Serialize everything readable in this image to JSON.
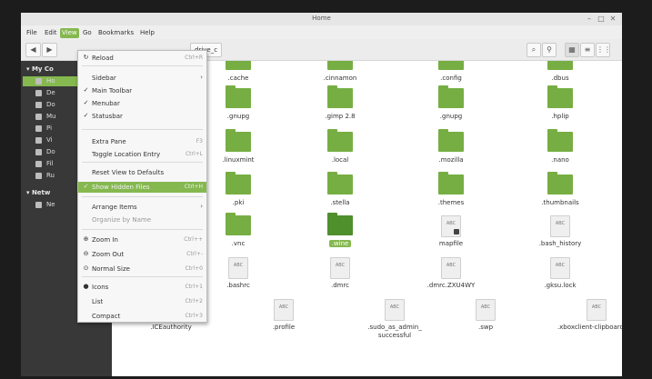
{
  "window": {
    "title": "Home"
  },
  "menubar": [
    "File",
    "Edit",
    "View",
    "Go",
    "Bookmarks",
    "Help"
  ],
  "toolbar": {
    "back_icon": "arrow-left-icon",
    "forward_icon": "arrow-right-icon",
    "path_crumb": "drive_c",
    "terminal_icon": "terminal-icon",
    "search_icon": "search-icon",
    "view_icons_icon": "grid-icon",
    "view_list_icon": "list-icon",
    "view_compact_icon": "compact-icon"
  },
  "sidebar": {
    "sections": [
      {
        "label": "My Co",
        "items": [
          "Ho",
          "De",
          "Do",
          "Mu",
          "Pi",
          "Vi",
          "Do",
          "Fil",
          "Ru"
        ]
      },
      {
        "label": "Netw",
        "items": [
          "Ne"
        ]
      }
    ]
  },
  "view_menu": {
    "items": [
      {
        "label": "Reload",
        "shortcut": "Ctrl+R",
        "mark": "↻"
      },
      {
        "label": "Sidebar",
        "shortcut": "",
        "mark": "",
        "submenu": true
      },
      {
        "label": "Main Toolbar",
        "shortcut": "",
        "mark": "✓"
      },
      {
        "label": "Menubar",
        "shortcut": "",
        "mark": "✓"
      },
      {
        "label": "Statusbar",
        "shortcut": "",
        "mark": "✓"
      },
      {
        "label": "Extra Pane",
        "shortcut": "F3",
        "mark": ""
      },
      {
        "label": "Toggle Location Entry",
        "shortcut": "Ctrl+L",
        "mark": ""
      },
      {
        "label": "Reset View to Defaults",
        "shortcut": "",
        "mark": ""
      },
      {
        "label": "Show Hidden Files",
        "shortcut": "Ctrl+H",
        "mark": "✓"
      },
      {
        "label": "Arrange Items",
        "shortcut": "",
        "mark": "",
        "submenu": true
      },
      {
        "label": "Organize by Name",
        "shortcut": "",
        "mark": ""
      },
      {
        "label": "Zoom In",
        "shortcut": "Ctrl++",
        "mark": "⊕"
      },
      {
        "label": "Zoom Out",
        "shortcut": "Ctrl+-",
        "mark": "⊖"
      },
      {
        "label": "Normal Size",
        "shortcut": "Ctrl+0",
        "mark": "⊙"
      },
      {
        "label": "Icons",
        "shortcut": "Ctrl+1",
        "mark": "●"
      },
      {
        "label": "List",
        "shortcut": "Ctrl+2",
        "mark": ""
      },
      {
        "label": "Compact",
        "shortcut": "Ctrl+3",
        "mark": ""
      }
    ]
  },
  "files": {
    "rows": [
      [
        ".cache",
        ".cinnamon",
        ".config",
        ".dbus"
      ],
      [
        ".gnupg",
        ".gimp 2.8",
        ".gnupg",
        ".hplip"
      ],
      [
        ".linuxmint",
        ".local",
        ".mozilla",
        ".nano"
      ],
      [
        ".pki",
        ".stella",
        ".themes",
        ".thumbnails"
      ],
      [
        ".vnc",
        ".wine",
        "mapfile",
        ".bash_history"
      ],
      [
        ".bashrc",
        ".dmrc",
        ".dmrc.ZXU4WY",
        ".gksu.lock"
      ],
      [
        ".ICEauthority",
        ".profile",
        ".sudo_as_admin_\nsuccessful",
        ".swp",
        ".xboxclient-clipboard.pid"
      ]
    ],
    "doc_tag": "ABC"
  }
}
